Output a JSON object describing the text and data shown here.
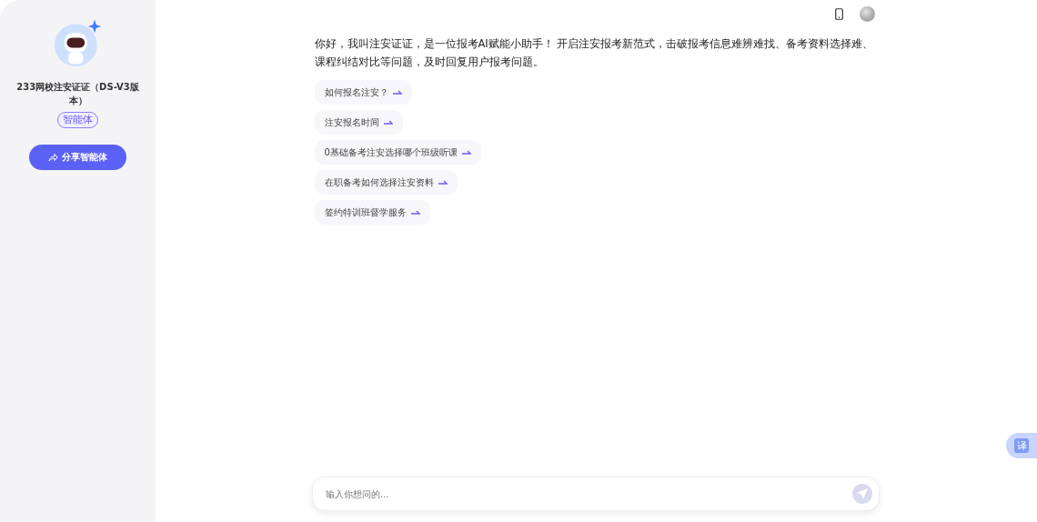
{
  "sidebar": {
    "agent_name": "233网校注安证证（DS-V3版本）",
    "badge": "智能体",
    "share_button": "分享智能体"
  },
  "chat": {
    "greeting": "你好，我叫注安证证，是一位报考AI赋能小助手！ 开启注安报考新范式，击破报考信息难辨难找、备考资料选择难、课程纠结对比等问题，及时回复用户报考问题。",
    "suggestions": [
      "如何报名注安？",
      "注安报名时间",
      "0基础备考注安选择哪个班级听课",
      "在职备考如何选择注安资料",
      "签约特训班督学服务"
    ]
  },
  "input": {
    "placeholder": "输入你想问的..."
  },
  "translate_button": "译"
}
